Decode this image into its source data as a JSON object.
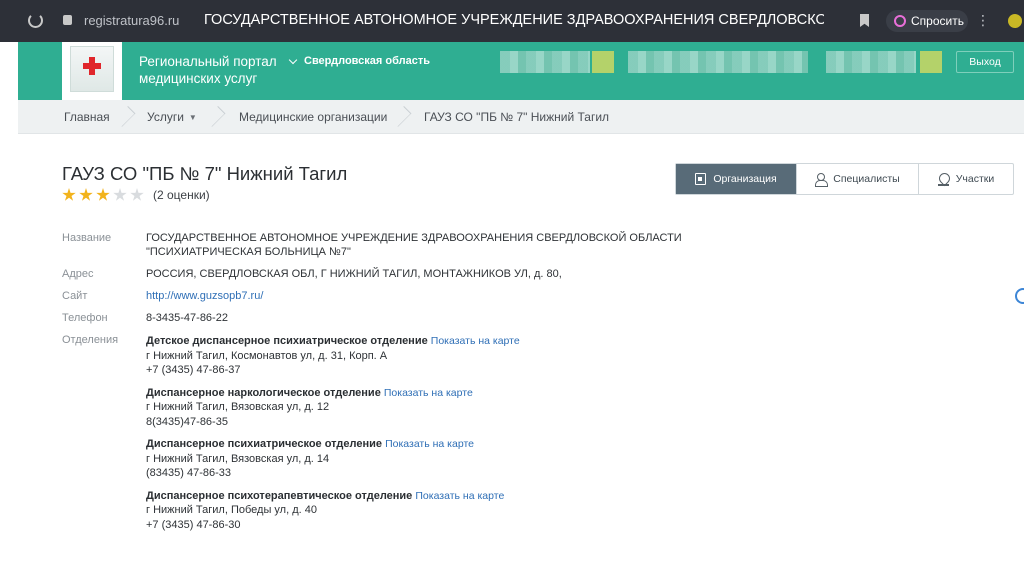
{
  "browser": {
    "url": "registratura96.ru",
    "tab_title": "ГОСУДАРСТВЕННОЕ АВТОНОМНОЕ УЧРЕЖДЕНИЕ ЗДРАВООХРАНЕНИЯ СВЕРДЛОВСКОЙ ОБЛАСТ...",
    "ask_label": "Спросить"
  },
  "header": {
    "portal_title": "Региональный портал медицинских услуг",
    "region": "Свердловская область",
    "logout_label": "Выход",
    "brand_color": "#2fae92"
  },
  "breadcrumb": {
    "items": [
      "Главная",
      "Услуги",
      "Медицинские организации",
      "ГАУЗ СО \"ПБ № 7\" Нижний Тагил"
    ]
  },
  "organization": {
    "title": "ГАУЗ СО \"ПБ № 7\" Нижний Тагил",
    "rating": {
      "stars_filled": 3,
      "stars_total": 5,
      "count_text": "(2 оценки)"
    },
    "tabs": [
      {
        "label": "Организация",
        "icon": "clipboard-icon",
        "active": true
      },
      {
        "label": "Специалисты",
        "icon": "doctor-icon",
        "active": false
      },
      {
        "label": "Участки",
        "icon": "map-pin-icon",
        "active": false
      }
    ],
    "fields": {
      "name_label": "Название",
      "name_value": "ГОСУДАРСТВЕННОЕ АВТОНОМНОЕ УЧРЕЖДЕНИЕ ЗДРАВООХРАНЕНИЯ СВЕРДЛОВСКОЙ ОБЛАСТИ \"ПСИХИАТРИЧЕСКАЯ БОЛЬНИЦА №7\"",
      "address_label": "Адрес",
      "address_value": "РОССИЯ, СВЕРДЛОВСКАЯ ОБЛ, Г НИЖНИЙ ТАГИЛ, МОНТАЖНИКОВ УЛ, д. 80,",
      "site_label": "Сайт",
      "site_value": "http://www.guzsopb7.ru/",
      "phone_label": "Телефон",
      "phone_value": "8-3435-47-86-22",
      "departments_label": "Отделения"
    },
    "departments": [
      {
        "name": "Детское диспансерное психиатрическое отделение",
        "map_link": "Показать на карте",
        "address": "г Нижний Тагил, Космонавтов ул, д. 31, Корп. А",
        "phone": "+7 (3435) 47-86-37"
      },
      {
        "name": "Диспансерное наркологическое отделение",
        "map_link": "Показать на карте",
        "address": "г Нижний Тагил, Вязовская ул, д. 12",
        "phone": "8(3435)47-86-35"
      },
      {
        "name": "Диспансерное психиатрическое отделение",
        "map_link": "Показать на карте",
        "address": "г Нижний Тагил, Вязовская ул, д. 14",
        "phone": "(83435) 47-86-33"
      },
      {
        "name": "Диспансерное психотерапевтическое отделение",
        "map_link": "Показать на карте",
        "address": "г Нижний Тагил, Победы ул, д. 40",
        "phone": "+7 (3435) 47-86-30"
      }
    ]
  }
}
